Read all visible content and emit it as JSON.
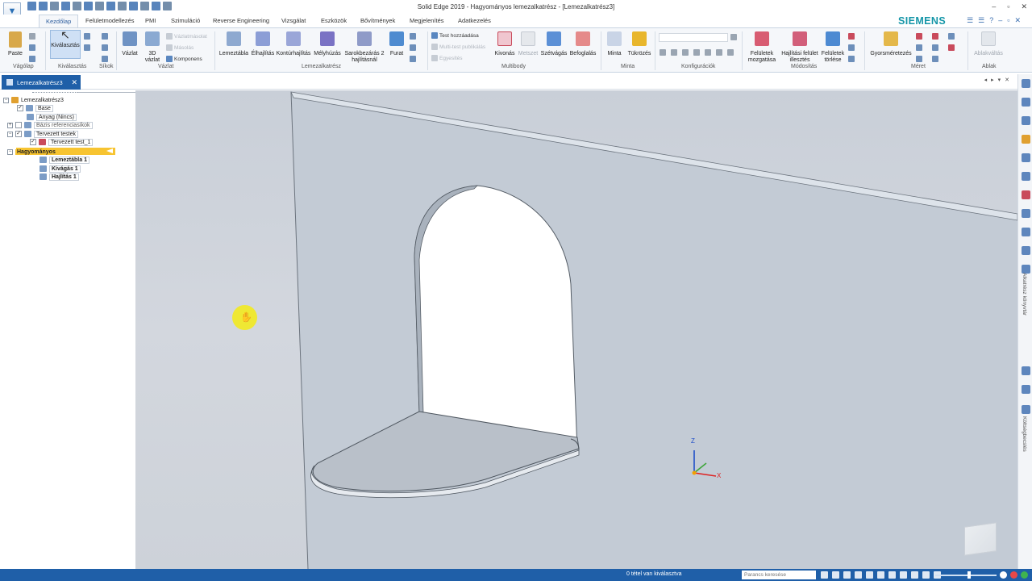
{
  "window": {
    "title": "Solid Edge 2019 - Hagyományos lemezalkatrész - [Lemezalkatrész3]",
    "brand": "SIEMENS",
    "controls": [
      "–",
      "▫",
      "✕"
    ]
  },
  "tabs": [
    {
      "label": "Kezdőlap",
      "active": true
    },
    {
      "label": "Felületmodellezés"
    },
    {
      "label": "PMI"
    },
    {
      "label": "Szimuláció"
    },
    {
      "label": "Reverse Engineering"
    },
    {
      "label": "Vizsgálat"
    },
    {
      "label": "Eszközök"
    },
    {
      "label": "Bővítmények"
    },
    {
      "label": "Megjelenítés"
    },
    {
      "label": "Adatkezelés"
    }
  ],
  "ribbon": {
    "paste": "Paste",
    "select": "Kiválasztás",
    "sketch": "Vázlat",
    "sketch3d_line1": "3D",
    "sketch3d_line2": "vázlat",
    "sketch_copy": "Vázlatmásolat",
    "copy": "Másolás",
    "components": "Komponens",
    "sheet_tab": "Lemeztábla",
    "flange": "Élhajlítás",
    "contour_flange": "Kontúrhajlítás",
    "dimple": "Mélyhúzás",
    "corner_close_line1": "Sarokbezárás 2",
    "corner_close_line2": "hajlításnál",
    "hole": "Furat",
    "add_body": "Test hozzáadása",
    "multibody_publish": "Multi-test publikálás",
    "union": "Egyesítés",
    "subtract": "Kivonás",
    "intersect": "Metszet",
    "split": "Szétvágás",
    "enclose": "Befoglalás",
    "pattern": "Minta",
    "mirror": "Tükrözés",
    "move_faces_line1": "Felületek",
    "move_faces_line2": "mozgatása",
    "bend_fit_line1": "Hajlítási felület",
    "bend_fit_line2": "illesztés",
    "delete_faces_line1": "Felületek",
    "delete_faces_line2": "törlése",
    "smart_dimension": "Gyorsméretezés",
    "window_select": "Ablakváltás",
    "groups": {
      "clipboard": "Vágólap",
      "select": "Kiválasztás",
      "planes": "Síkok",
      "sketch": "Vázlat",
      "sheet_metal": "Lemezalkatrész",
      "multibody": "Multibody",
      "pattern": "Minta",
      "configurations": "Konfigurációk",
      "modify": "Módosítás",
      "dimension": "Méret",
      "window": "Ablak"
    }
  },
  "document_tab": {
    "label": "Lemezalkatrész3"
  },
  "pathfinder": {
    "items": [
      {
        "label": "Lemezalkatrész3"
      },
      {
        "label": "Base"
      },
      {
        "label": "Anyag (Nincs)"
      },
      {
        "label": "Bázis referenciasíkok"
      },
      {
        "label": "Tervezett testek"
      },
      {
        "label": "Tervezett test_1"
      },
      {
        "label": "Hagyományos"
      },
      {
        "label": "Lemeztábla 1"
      },
      {
        "label": "Kivágás 1"
      },
      {
        "label": "Hajlítás 1"
      }
    ]
  },
  "triad": {
    "z": "Z",
    "x": "X"
  },
  "right_panel": {
    "library_label": "Alkatrész könyvtár",
    "cost_label": "Költségbecslés"
  },
  "status": {
    "selection": "0 tétel van kiválasztva",
    "command_search_placeholder": "Parancs keresése"
  },
  "colors": {
    "accent": "#1f5fa8",
    "brand": "#1596a8",
    "highlight": "#f7c431"
  }
}
